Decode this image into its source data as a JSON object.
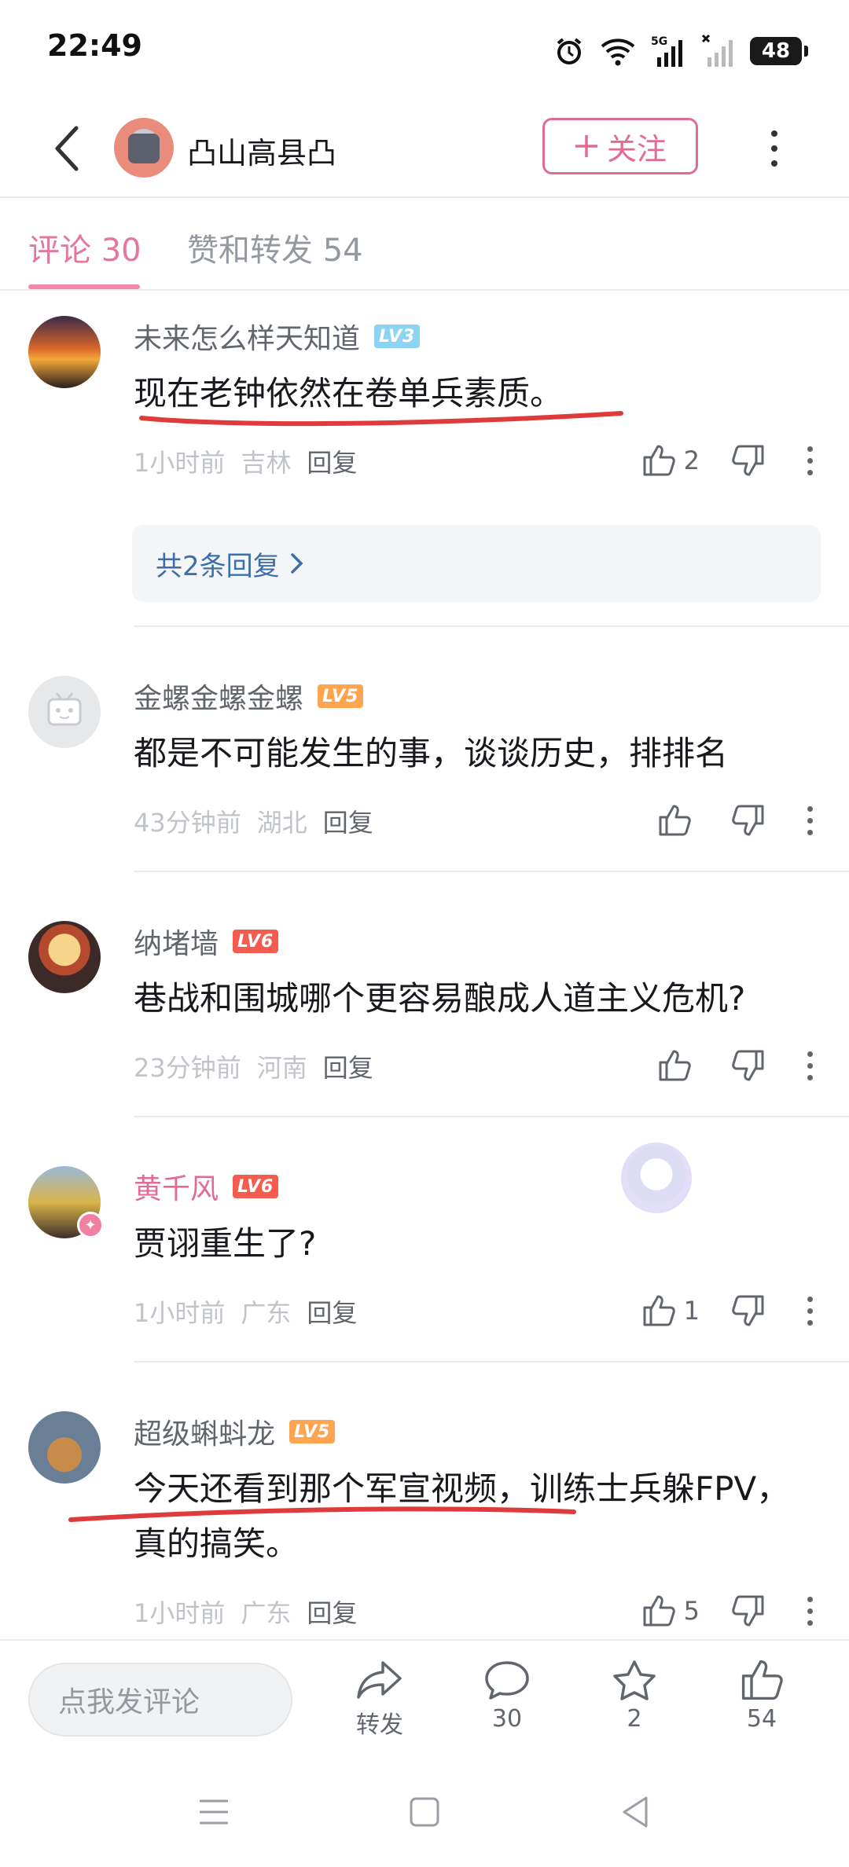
{
  "status": {
    "time": "22:49",
    "battery": "48"
  },
  "header": {
    "name": "凸山高县凸",
    "follow_label": "关注"
  },
  "tabs": [
    {
      "label": "评论 30"
    },
    {
      "label": "赞和转发 54"
    }
  ],
  "comments": [
    {
      "name": "未来怎么样天知道",
      "level": "LV3",
      "text": "现在老钟依然在卷单兵素质。",
      "time": "1小时前",
      "location": "吉林",
      "reply": "回复",
      "likes": "2",
      "replies_summary": "共2条回复"
    },
    {
      "name": "金螺金螺金螺",
      "level": "LV5",
      "text": "都是不可能发生的事，谈谈历史，排排名",
      "time": "43分钟前",
      "location": "湖北",
      "reply": "回复",
      "likes": ""
    },
    {
      "name": "纳堵墙",
      "level": "LV6",
      "text": "巷战和围城哪个更容易酿成人道主义危机?",
      "time": "23分钟前",
      "location": "河南",
      "reply": "回复",
      "likes": ""
    },
    {
      "name": "黄千风",
      "level": "LV6",
      "text": "贾诩重生了?",
      "time": "1小时前",
      "location": "广东",
      "reply": "回复",
      "likes": "1"
    },
    {
      "name": "超级蝌蚪龙",
      "level": "LV5",
      "text": "今天还看到那个军宣视频，训练士兵躲FPV，真的搞笑。",
      "time": "1小时前",
      "location": "广东",
      "reply": "回复",
      "likes": "5"
    }
  ],
  "bottom_bar": {
    "input_placeholder": "点我发评论",
    "share_label": "转发",
    "comment_count": "30",
    "favorite_count": "2",
    "like_count": "54"
  },
  "colors": {
    "accent_pink": "#e06d91",
    "underline_red": "#e03b3b",
    "link_blue": "#3d6ea8"
  }
}
